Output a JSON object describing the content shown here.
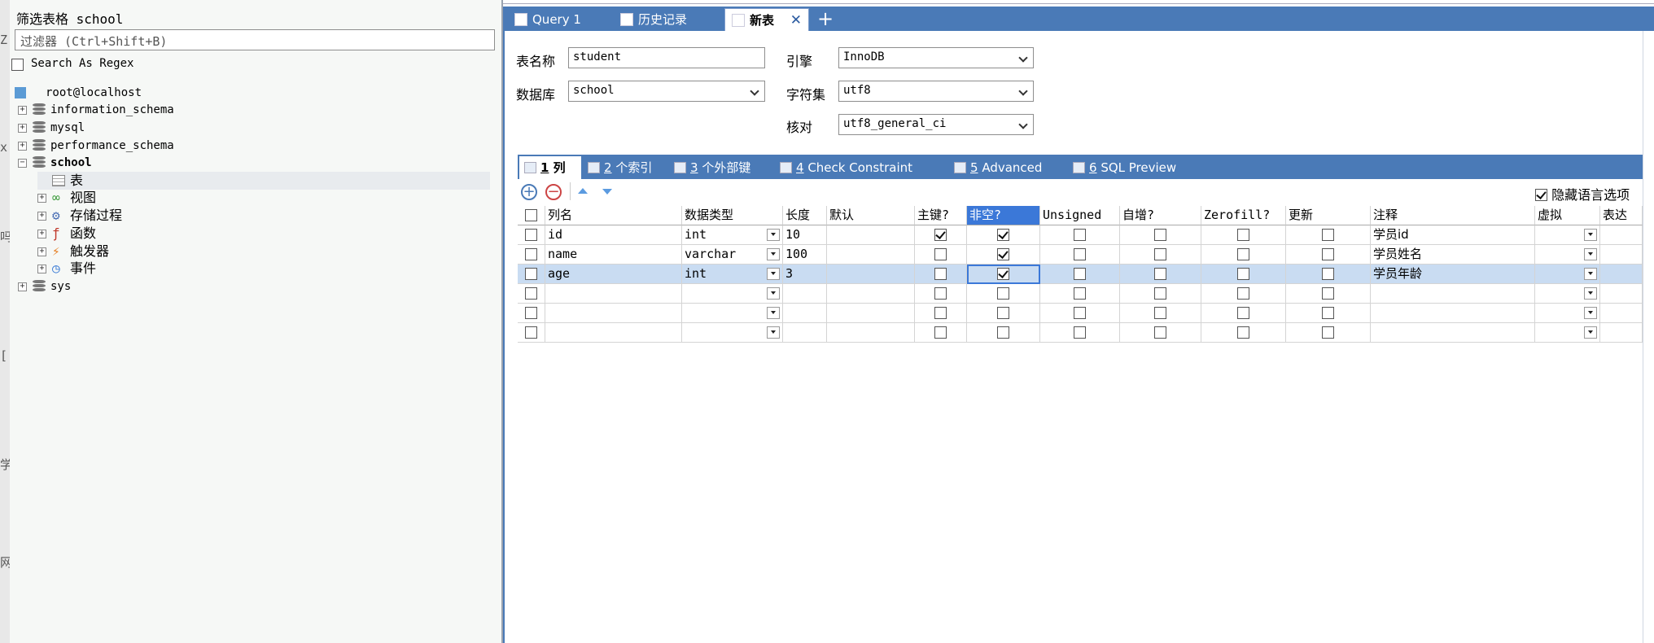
{
  "left_pane": {
    "title": "筛选表格 school",
    "filter_placeholder": "过滤器 (Ctrl+Shift+B)",
    "regex_label": "Search As Regex",
    "connection": "root@localhost",
    "databases": [
      "information_schema",
      "mysql",
      "performance_schema",
      "school"
    ],
    "school_children": [
      "表",
      "视图",
      "存储过程",
      "函数",
      "触发器",
      "事件"
    ],
    "last_db": "sys",
    "edge_glyphs": [
      "Z",
      "x",
      "吗",
      "[",
      "学",
      "网"
    ]
  },
  "tabs": [
    {
      "label": "Query 1"
    },
    {
      "label": "历史记录"
    },
    {
      "label": "新表",
      "active": true,
      "close": "✕"
    }
  ],
  "add_tab": "+",
  "form": {
    "table_name_label": "表名称",
    "table_name_value": "student",
    "database_label": "数据库",
    "database_value": "school",
    "engine_label": "引擎",
    "engine_value": "InnoDB",
    "charset_label": "字符集",
    "charset_value": "utf8",
    "collation_label": "核对",
    "collation_value": "utf8_general_ci"
  },
  "subtabs": [
    {
      "num": "1",
      "label": "列",
      "active": true
    },
    {
      "num": "2",
      "label": "个索引"
    },
    {
      "num": "3",
      "label": "个外部键"
    },
    {
      "num": "4",
      "label": "Check Constraint"
    },
    {
      "num": "5",
      "label": "Advanced"
    },
    {
      "num": "6",
      "label": "SQL Preview"
    }
  ],
  "hide_lang_label": "隐藏语言选项",
  "columns_header": [
    "列名",
    "数据类型",
    "长度",
    "默认",
    "主键?",
    "非空?",
    "Unsigned",
    "自增?",
    "Zerofill?",
    "更新",
    "注释",
    "虚拟",
    "表达"
  ],
  "rows": [
    {
      "name": "id",
      "type": "int",
      "length": "10",
      "default": "",
      "pk": true,
      "notnull": true,
      "unsigned": false,
      "autoinc": false,
      "zerofill": false,
      "update": false,
      "comment": "学员id"
    },
    {
      "name": "name",
      "type": "varchar",
      "length": "100",
      "default": "",
      "pk": false,
      "notnull": true,
      "unsigned": false,
      "autoinc": false,
      "zerofill": false,
      "update": false,
      "comment": "学员姓名"
    },
    {
      "name": "age",
      "type": "int",
      "length": "3",
      "default": "",
      "pk": false,
      "notnull": true,
      "unsigned": false,
      "autoinc": false,
      "zerofill": false,
      "update": false,
      "comment": "学员年龄"
    },
    {
      "name": "",
      "type": "",
      "length": "",
      "default": "",
      "pk": false,
      "notnull": false,
      "unsigned": false,
      "autoinc": false,
      "zerofill": false,
      "update": false,
      "comment": ""
    },
    {
      "name": "",
      "type": "",
      "length": "",
      "default": "",
      "pk": false,
      "notnull": false,
      "unsigned": false,
      "autoinc": false,
      "zerofill": false,
      "update": false,
      "comment": ""
    },
    {
      "name": "",
      "type": "",
      "length": "",
      "default": "",
      "pk": false,
      "notnull": false,
      "unsigned": false,
      "autoinc": false,
      "zerofill": false,
      "update": false,
      "comment": ""
    }
  ],
  "colors": {
    "accent": "#4a7ab7",
    "selected_row": "#c9dcf2",
    "header_highlight": "#3b78d8"
  }
}
